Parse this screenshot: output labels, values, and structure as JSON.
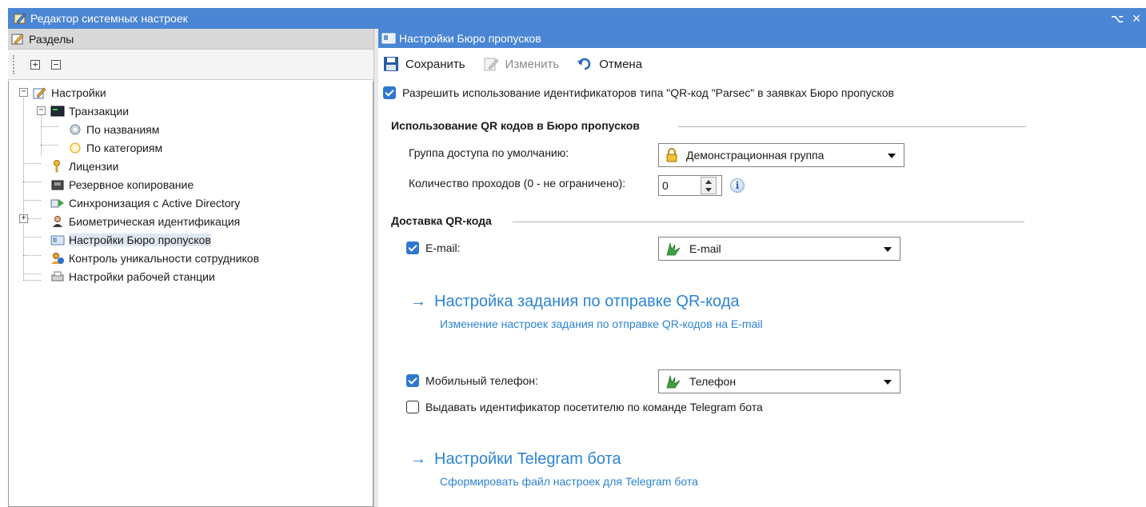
{
  "window": {
    "title": "Редактор системных настроек",
    "pin_glyph": "⌥",
    "close_glyph": "✕"
  },
  "left": {
    "header": "Разделы",
    "expand_all_glyph": "+",
    "collapse_all_glyph": "−",
    "tree": [
      {
        "label": "Настройки",
        "icon": "settings-edit-icon"
      },
      {
        "label": "Транзакции",
        "icon": "terminal-icon"
      },
      {
        "label": "По названиям",
        "icon": "gear-icon"
      },
      {
        "label": "По категориям",
        "icon": "gears-icon"
      },
      {
        "label": "Лицензии",
        "icon": "key-icon"
      },
      {
        "label": "Резервное копирование",
        "icon": "backup-icon"
      },
      {
        "label": "Синхронизация с Active Directory",
        "icon": "sync-icon"
      },
      {
        "label": "Биометрическая идентификация",
        "icon": "person-icon"
      },
      {
        "label": "Настройки Бюро пропусков",
        "icon": "id-card-icon"
      },
      {
        "label": "Контроль уникальности сотрудников",
        "icon": "user-info-icon"
      },
      {
        "label": "Настройки рабочей станции",
        "icon": "printer-icon"
      }
    ]
  },
  "right": {
    "header": "Настройки Бюро пропусков",
    "toolbar": {
      "save": "Сохранить",
      "edit": "Изменить",
      "cancel": "Отмена"
    },
    "allow_qr_label": "Разрешить использование идентификаторов типа \"QR-код \"Parsec\" в заявках Бюро пропусков",
    "qr_section_title": "Использование QR кодов в Бюро пропусков",
    "default_group_label": "Группа доступа по умолчанию:",
    "default_group_value": "Демонстрационная группа",
    "passes_label": "Количество проходов (0 - не ограничено):",
    "passes_value": "0",
    "info_glyph": "i",
    "delivery_section_title": "Доставка QR-кода",
    "email_label": "E-mail:",
    "email_value": "E-mail",
    "link1_arrow": "→",
    "link1_title": "Настройка задания по отправке QR-кода",
    "link1_sub": "Изменение настроек задания по отправке QR-кодов на E-mail",
    "phone_label": "Мобильный телефон:",
    "phone_value": "Телефон",
    "telegram_label": "Выдавать идентификатор посетителю по команде Telegram бота",
    "link2_arrow": "→",
    "link2_title": "Настройки Telegram бота",
    "link2_sub": "Сформировать файл настроек для Telegram бота"
  },
  "colors": {
    "titlebar": "#4a86d4",
    "link": "#2c84d4",
    "checkbox": "#2f78d0"
  }
}
